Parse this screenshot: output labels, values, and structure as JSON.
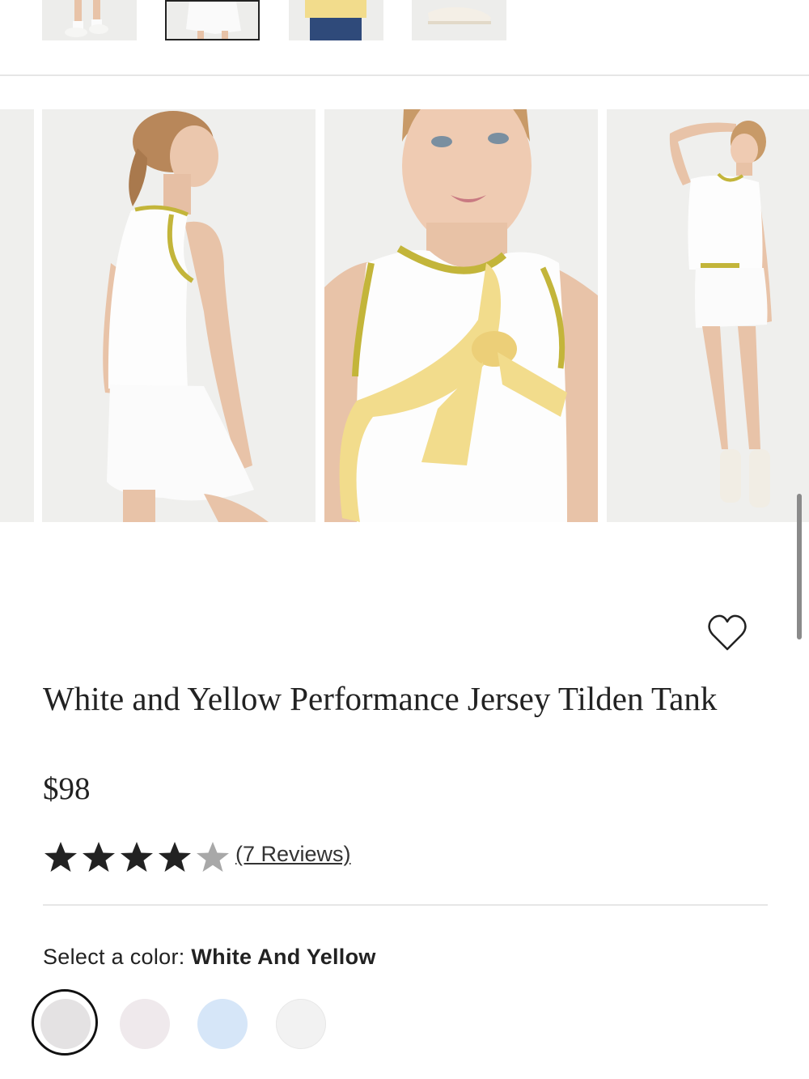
{
  "product": {
    "title": "White and Yellow Performance Jersey Tilden Tank",
    "price": "$98",
    "rating": 4,
    "rating_max": 5,
    "reviews_label": "(7 Reviews)"
  },
  "color_selector": {
    "label": "Select a color:",
    "selected": "White And Yellow",
    "swatches": [
      {
        "color": "#e4e2e3",
        "selected": true
      },
      {
        "color": "#efe9ec",
        "selected": false
      },
      {
        "color": "#d6e6f8",
        "selected": false
      },
      {
        "color": "#f2f2f2",
        "selected": false
      }
    ]
  },
  "icons": {
    "favorite": "heart-icon",
    "star": "star-icon"
  },
  "colors": {
    "text": "#222222",
    "star_filled": "#222222",
    "star_empty": "#a8a8a8",
    "accent_trim": "#c3b53a",
    "sweater_yellow": "#f2dc8c"
  }
}
